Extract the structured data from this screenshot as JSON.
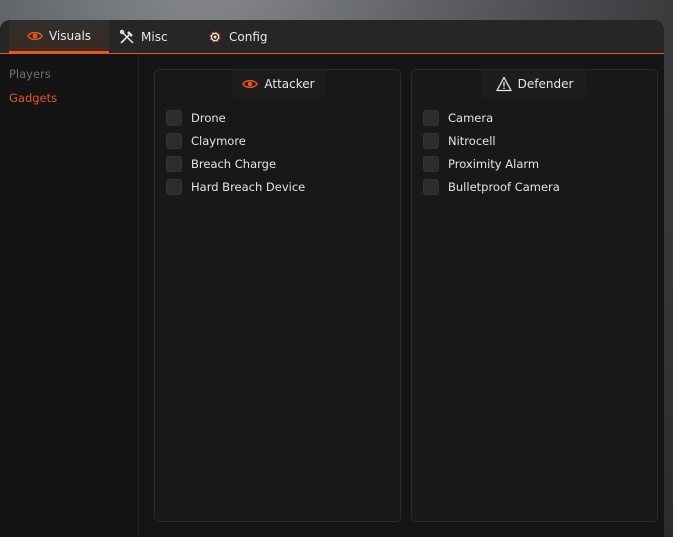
{
  "colors": {
    "accent": "#e8561c",
    "panel": "#181818",
    "muted": "#6f6f6f"
  },
  "tabs": [
    {
      "label": "Visuals",
      "icon": "eye-icon",
      "active": true
    },
    {
      "label": "Misc",
      "icon": "tools-icon",
      "active": false
    },
    {
      "label": "Config",
      "icon": "gear-icon",
      "active": false
    }
  ],
  "sidebar": {
    "items": [
      {
        "label": "Players",
        "active": false
      },
      {
        "label": "Gadgets",
        "active": true
      }
    ]
  },
  "panels": {
    "attacker": {
      "title": "Attacker",
      "icon": "eye-icon",
      "options": [
        {
          "label": "Drone",
          "checked": false
        },
        {
          "label": "Claymore",
          "checked": false
        },
        {
          "label": "Breach Charge",
          "checked": false
        },
        {
          "label": "Hard Breach Device",
          "checked": false
        }
      ]
    },
    "defender": {
      "title": "Defender",
      "icon": "warning-icon",
      "options": [
        {
          "label": "Camera",
          "checked": false
        },
        {
          "label": "Nitrocell",
          "checked": false
        },
        {
          "label": "Proximity Alarm",
          "checked": false
        },
        {
          "label": "Bulletproof Camera",
          "checked": false
        }
      ]
    }
  }
}
